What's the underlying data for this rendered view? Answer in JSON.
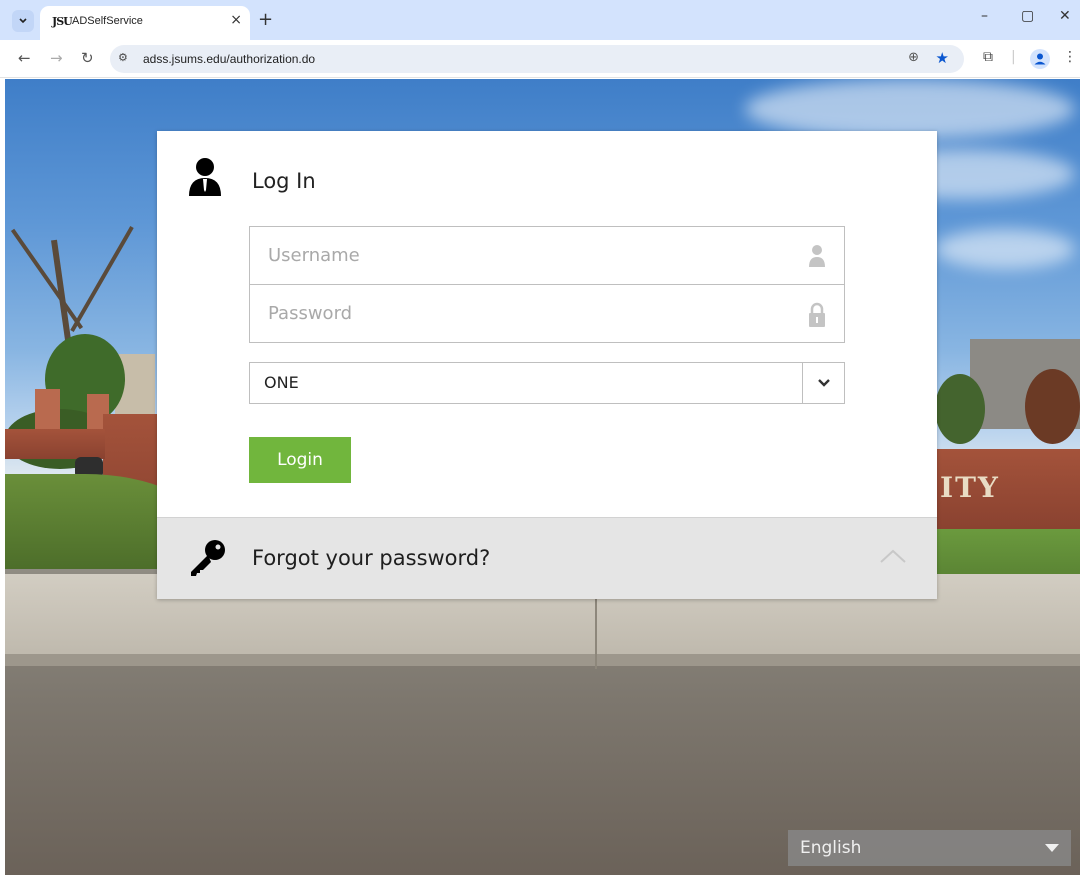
{
  "browser": {
    "tab_title": "ADSelfService",
    "tab_favicon_text": "JSU",
    "url": "adss.jsums.edu/authorization.do",
    "new_tab_label": "+",
    "close_tab_label": "×"
  },
  "login": {
    "title": "Log In",
    "username_placeholder": "Username",
    "password_placeholder": "Password",
    "domain_selected": "ONE",
    "login_button": "Login",
    "forgot_password": "Forgot your password?"
  },
  "language": {
    "selected": "English"
  },
  "colors": {
    "login_button": "#71b63d",
    "forgot_bar": "#e5e5e5",
    "tabstrip": "#d3e3fd"
  },
  "icons": {
    "user": "user-silhouette",
    "username_field": "person",
    "password_field": "padlock",
    "forgot": "key",
    "dropdown": "chevron-down",
    "collapse": "chevron-up"
  }
}
